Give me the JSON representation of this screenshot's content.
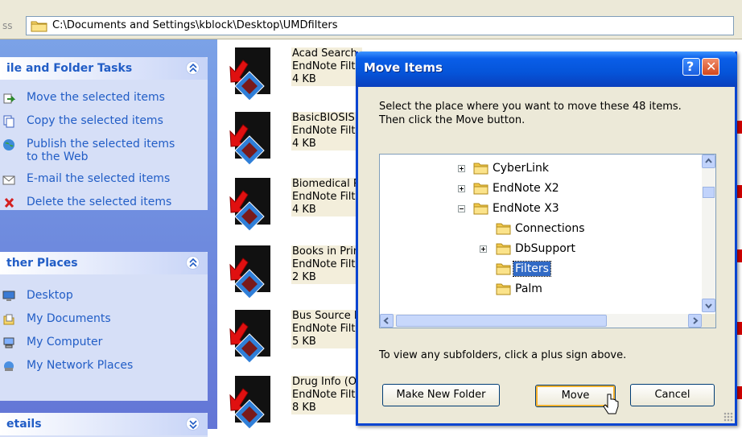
{
  "address": {
    "label": "ss",
    "path": "C:\\Documents and Settings\\kblock\\Desktop\\UMDfilters"
  },
  "task_pane": {
    "file_tasks": {
      "title": "ile and Folder Tasks",
      "items": [
        {
          "label": "Move the selected items",
          "icon": "move-icon"
        },
        {
          "label": "Copy the selected items",
          "icon": "copy-icon"
        },
        {
          "label": "Publish the selected items",
          "label2": "to the Web",
          "icon": "publish-web-icon"
        },
        {
          "label": "E-mail the selected items",
          "icon": "email-icon"
        },
        {
          "label": "Delete the selected items",
          "icon": "delete-icon"
        }
      ]
    },
    "other_places": {
      "title": "ther Places",
      "items": [
        {
          "label": "Desktop",
          "icon": "desktop-icon"
        },
        {
          "label": "My Documents",
          "icon": "my-documents-icon"
        },
        {
          "label": "My Computer",
          "icon": "my-computer-icon"
        },
        {
          "label": "My Network Places",
          "icon": "network-places-icon"
        }
      ]
    },
    "details": {
      "title": "etails"
    }
  },
  "files": [
    {
      "name": "Acad Search",
      "type": "EndNote Filte",
      "size": "4 KB"
    },
    {
      "name": "BasicBIOSIS",
      "type": "EndNote Filte",
      "size": "4 KB"
    },
    {
      "name": "Biomedical Re",
      "type": "EndNote Filte",
      "size": "4 KB"
    },
    {
      "name": "Books in Print",
      "type": "EndNote Filte",
      "size": "2 KB"
    },
    {
      "name": "Bus Source P",
      "type": "EndNote Filte",
      "size": "5 KB"
    },
    {
      "name": "Drug Info (O",
      "type": "EndNote Filte",
      "size": "8 KB"
    }
  ],
  "dialog": {
    "title": "Move Items",
    "help_glyph": "?",
    "close_glyph": "✕",
    "message_line1": "Select the place where you want to move these 48 items.",
    "message_line2": "Then click the Move button.",
    "tree": [
      {
        "label": "CyberLink",
        "expander": "plus"
      },
      {
        "label": "EndNote X2",
        "expander": "plus"
      },
      {
        "label": "EndNote X3",
        "expander": "minus"
      },
      {
        "label": "Connections",
        "expander": "none"
      },
      {
        "label": "DbSupport",
        "expander": "plus"
      },
      {
        "label": "Filters",
        "expander": "none",
        "selected": true
      },
      {
        "label": "Palm",
        "expander": "none"
      }
    ],
    "hint": "To view any subfolders, click a plus sign above.",
    "buttons": {
      "new_folder": "Make New Folder",
      "move": "Move",
      "cancel": "Cancel"
    }
  },
  "colors": {
    "title_blue": "#0554d9",
    "task_link": "#215dc6",
    "selection": "#316ac5"
  }
}
